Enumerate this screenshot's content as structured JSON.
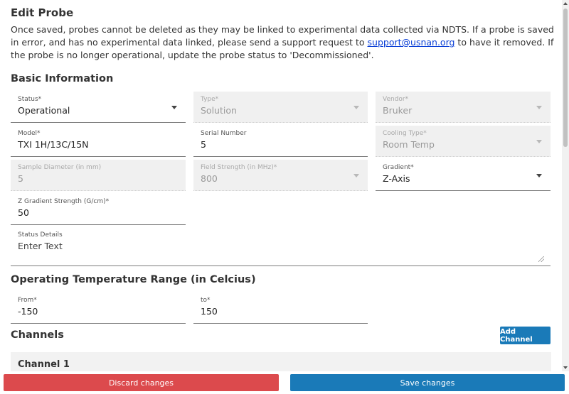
{
  "page": {
    "title": "Edit Probe",
    "intro_before": "Once saved, probes cannot be deleted as they may be linked to experimental data collected via NDTS. If a probe is saved in error, and has no experimental data linked, please send a support request to ",
    "support_email": "support@usnan.org",
    "intro_after": " to have it removed. If the probe is no longer operational, update the probe status to 'Decommissioned'."
  },
  "basic": {
    "heading": "Basic Information",
    "status": {
      "label": "Status*",
      "value": "Operational"
    },
    "type": {
      "label": "Type*",
      "value": "Solution"
    },
    "vendor": {
      "label": "Vendor*",
      "value": "Bruker"
    },
    "model": {
      "label": "Model*",
      "value": "TXI 1H/13C/15N"
    },
    "serial": {
      "label": "Serial Number",
      "value": "5"
    },
    "cooling": {
      "label": "Cooling Type*",
      "value": "Room Temp"
    },
    "diameter": {
      "label": "Sample Diameter (in mm)",
      "value": "5"
    },
    "field_strength": {
      "label": "Field Strength (in MHz)*",
      "value": "800"
    },
    "gradient": {
      "label": "Gradient*",
      "value": "Z-Axis"
    },
    "z_gradient": {
      "label": "Z Gradient Strength (G/cm)*",
      "value": "50"
    },
    "status_details": {
      "label": "Status Details",
      "value": "Enter Text"
    }
  },
  "temperature": {
    "heading": "Operating Temperature Range (in Celcius)",
    "from": {
      "label": "From*",
      "value": "-150"
    },
    "to": {
      "label": "to*",
      "value": "150"
    }
  },
  "channels": {
    "heading": "Channels",
    "add_label": "Add Channel",
    "items": [
      {
        "title": "Channel 1"
      }
    ]
  },
  "footer": {
    "discard_label": "Discard changes",
    "save_label": "Save changes"
  },
  "colors": {
    "primary": "#1a7ab8",
    "danger": "#dc4a4d",
    "link": "#0a3fd6"
  }
}
